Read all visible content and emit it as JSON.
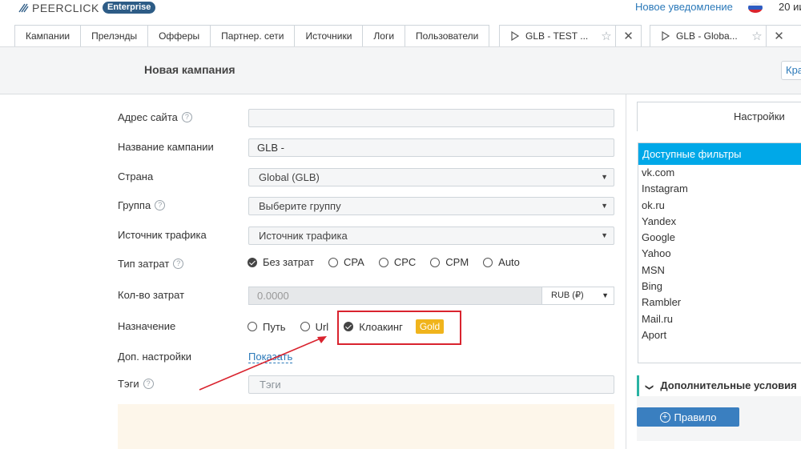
{
  "topbar": {
    "logo_text": "PEERCLICK",
    "plan_badge": "Enterprise",
    "notification_link": "Новое уведомление",
    "date_text": "20 ии"
  },
  "nav_tabs": [
    "Кампании",
    "Прелэнды",
    "Офферы",
    "Партнер. сети",
    "Источники",
    "Логи",
    "Пользователи"
  ],
  "open_tabs": [
    {
      "title": "GLB - TEST ..."
    },
    {
      "title": "GLB - Globa..."
    }
  ],
  "header": {
    "title": "Новая кампания",
    "action_partial": "Кра"
  },
  "form": {
    "site_address": {
      "label": "Адрес сайта",
      "value": ""
    },
    "campaign_name": {
      "label": "Название кампании",
      "value": "GLB -"
    },
    "country": {
      "label": "Страна",
      "value": "Global (GLB)"
    },
    "group": {
      "label": "Группа",
      "value": "Выберите группу"
    },
    "traffic_source": {
      "label": "Источник трафика",
      "value": "Источник трафика"
    },
    "cost_type": {
      "label": "Тип затрат",
      "options": [
        "Без затрат",
        "CPA",
        "CPC",
        "CPM",
        "Auto"
      ],
      "selected": "Без затрат"
    },
    "cost_amount": {
      "label": "Кол-во затрат",
      "value": "0.0000",
      "currency": "RUB (₽)"
    },
    "destination": {
      "label": "Назначение",
      "options": [
        "Путь",
        "Url",
        "Клоакинг"
      ],
      "selected": "Клоакинг",
      "gold_badge": "Gold"
    },
    "extra_settings": {
      "label": "Доп. настройки",
      "link": "Показать"
    },
    "tags": {
      "label": "Тэги",
      "placeholder": "Тэги"
    }
  },
  "right_panel": {
    "settings_tab": "Настройки",
    "filters_title": "Доступные фильтры",
    "filters": [
      "vk.com",
      "Instagram",
      "ok.ru",
      "Yandex",
      "Google",
      "Yahoo",
      "MSN",
      "Bing",
      "Rambler",
      "Mail.ru",
      "Aport"
    ],
    "conditions_title": "Дополнительные условия",
    "rule_button": "Правило"
  },
  "colors": {
    "accent_blue": "#2b79b9",
    "filters_header": "#00a8e8",
    "highlight_red": "#d9232e",
    "gold": "#f0b41c",
    "button_blue": "#3a7fc0"
  }
}
